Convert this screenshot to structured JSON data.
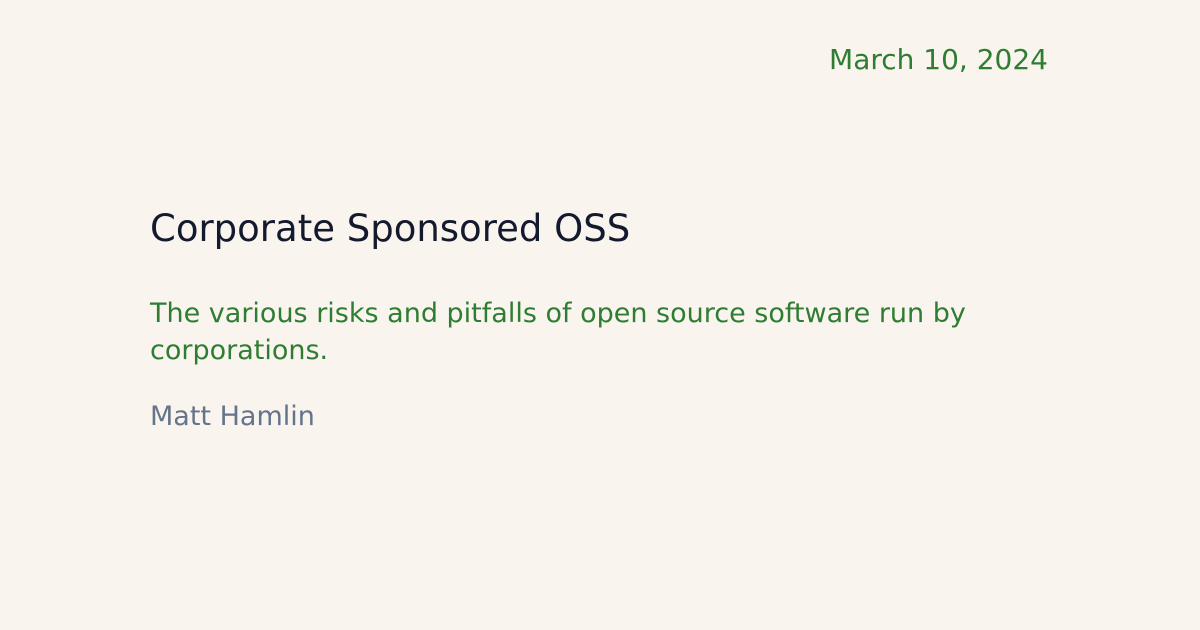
{
  "post": {
    "date": "March 10, 2024",
    "title": "Corporate Sponsored OSS",
    "description": "The various risks and pitfalls of open source software run by corporations.",
    "author": "Matt Hamlin"
  },
  "colors": {
    "background": "#f9f4ee",
    "accent": "#2e7d32",
    "title": "#141a2e",
    "author": "#64748b"
  }
}
